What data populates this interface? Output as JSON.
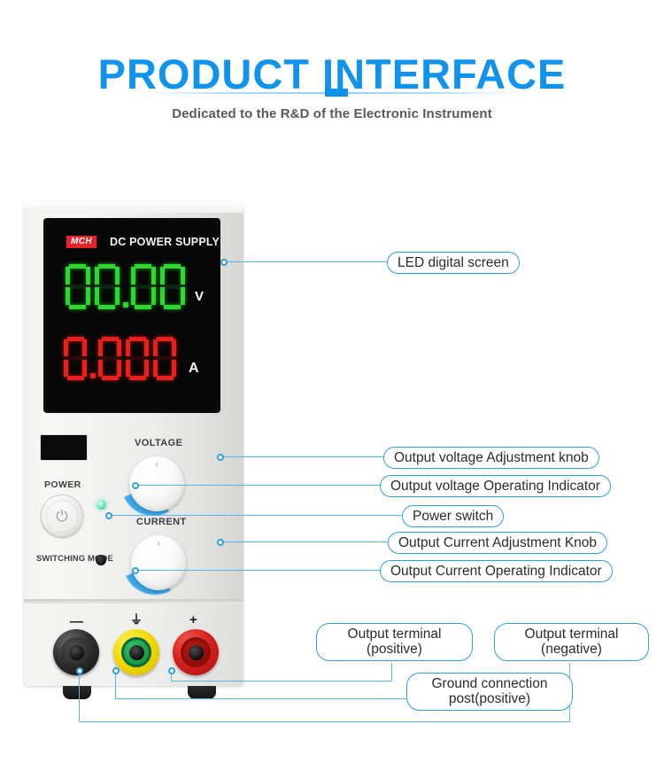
{
  "header": {
    "title": "PRODUCT INTERFACE",
    "subtitle": "Dedicated to the R&D of the Electronic Instrument",
    "accent_color": "#0d93ec",
    "subtitle_color": "#58595b"
  },
  "device": {
    "brand": "MCH",
    "model_title": "DC POWER SUPPLY",
    "brand_badge_color": "#e8222a",
    "display": {
      "voltage": {
        "value": "00.00",
        "unit": "V",
        "color": "#2fd62f",
        "digits": [
          "0",
          "0",
          ".",
          "0",
          "0"
        ]
      },
      "current": {
        "value": "0.000",
        "unit": "A",
        "color": "#e8201c",
        "digits": [
          "0",
          ".",
          "0",
          "0",
          "0"
        ]
      }
    },
    "controls": {
      "power_label": "POWER",
      "voltage_label": "VOLTAGE",
      "current_label": "CURRENT",
      "switching_mode_label": "SWITCHING MODE",
      "power_glyph": "⏻",
      "voltage_indicator_color": "#6fe3bd",
      "current_indicator_color": "#141414",
      "knob_accent_color": "#3ba7ea"
    },
    "terminals": [
      {
        "name": "negative",
        "symbol": "—",
        "color": "#2e2e2e"
      },
      {
        "name": "ground",
        "symbol": "⏚",
        "color": "#f5d800"
      },
      {
        "name": "positive",
        "symbol": "+",
        "color": "#d8211c"
      }
    ]
  },
  "callouts": {
    "border_color": "#2f9fe0",
    "line_color": "#5bb4e8",
    "items": [
      {
        "id": "led-screen",
        "label": "LED digital screen"
      },
      {
        "id": "voltage-knob",
        "label": "Output voltage Adjustment knob"
      },
      {
        "id": "voltage-indicator",
        "label": "Output voltage Operating Indicator"
      },
      {
        "id": "power-switch",
        "label": "Power switch"
      },
      {
        "id": "current-knob",
        "label": "Output Current Adjustment Knob"
      },
      {
        "id": "current-indicator",
        "label": "Output Current Operating Indicator"
      },
      {
        "id": "terminal-positive",
        "line1": "Output terminal",
        "line2": "(positive)"
      },
      {
        "id": "terminal-negative",
        "line1": "Output terminal",
        "line2": "(negative)"
      },
      {
        "id": "ground-post",
        "line1": "Ground connection",
        "line2": "post(positive)"
      }
    ]
  }
}
